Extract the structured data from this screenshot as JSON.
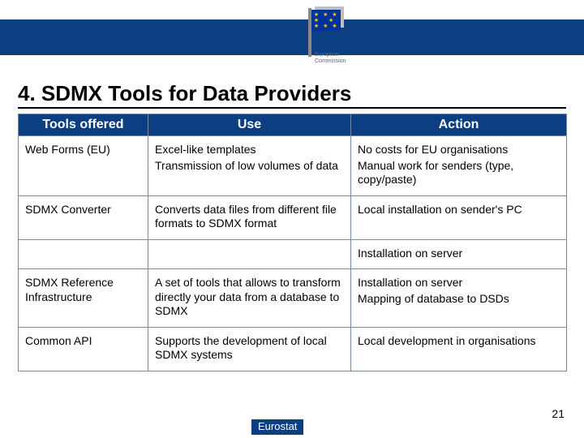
{
  "header": {
    "logo_text_line1": "European",
    "logo_text_line2": "Commission"
  },
  "title": "4. SDMX Tools for Data Providers",
  "table": {
    "columns": [
      "Tools offered",
      "Use",
      "Action"
    ],
    "rows": [
      {
        "name": "Web Forms (EU)",
        "use_lines": [
          "Excel-like templates",
          "Transmission of low volumes of data"
        ],
        "action_lines": [
          "No costs for EU organisations",
          "Manual work for senders (type, copy/paste)"
        ]
      },
      {
        "name": "SDMX Converter",
        "use_lines": [
          "Converts data files from different file formats to SDMX format"
        ],
        "action_lines": [
          "Local installation on sender's PC"
        ]
      },
      {
        "name": "",
        "use_lines": [
          ""
        ],
        "action_lines": [
          "Installation on server"
        ]
      },
      {
        "name": "SDMX Reference Infrastructure",
        "use_lines": [
          "A set of tools that allows to transform directly your data from a database to SDMX"
        ],
        "action_lines": [
          "Installation on server",
          "Mapping of database to DSDs"
        ]
      },
      {
        "name": "Common API",
        "use_lines": [
          "Supports the development of local SDMX systems"
        ],
        "action_lines": [
          "Local development in organisations"
        ]
      }
    ]
  },
  "page_number": "21",
  "footer_label": "Eurostat"
}
